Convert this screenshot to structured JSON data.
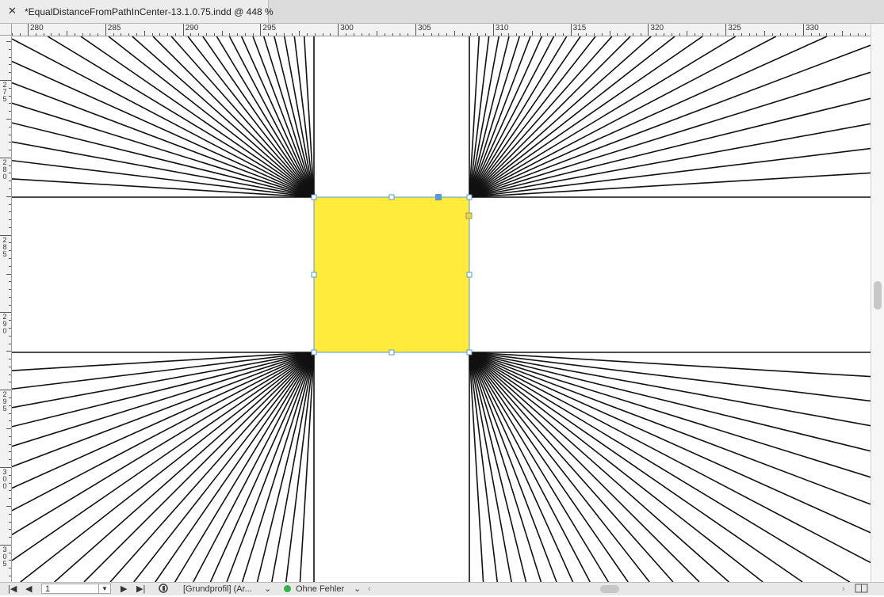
{
  "tab": {
    "close_glyph": "✕",
    "title": "*EqualDistanceFromPathInCenter-13.1.0.75.indd @ 448 %"
  },
  "ruler": {
    "h_labels": [
      "280",
      "285",
      "290",
      "295",
      "300",
      "305",
      "310",
      "315",
      "320",
      "325",
      "330"
    ],
    "v_labels": [
      "275",
      "280",
      "285",
      "290",
      "295",
      "300",
      "305"
    ]
  },
  "colors": {
    "fill": "#ffeb3b",
    "frame": "#5a9bd5",
    "lines": "#111111"
  },
  "status": {
    "page_value": "1",
    "profile": "[Grundprofil] (Ar...",
    "errors": "Ohne Fehler",
    "first_glyph": "|◀",
    "prev_glyph": "◀",
    "next_glyph": "▶",
    "last_glyph": "▶|",
    "chevron": "⌄",
    "scroll_left": "‹",
    "scroll_right": "›",
    "icons": {
      "preflight": "preflight-icon",
      "split": "split-view-icon"
    }
  }
}
